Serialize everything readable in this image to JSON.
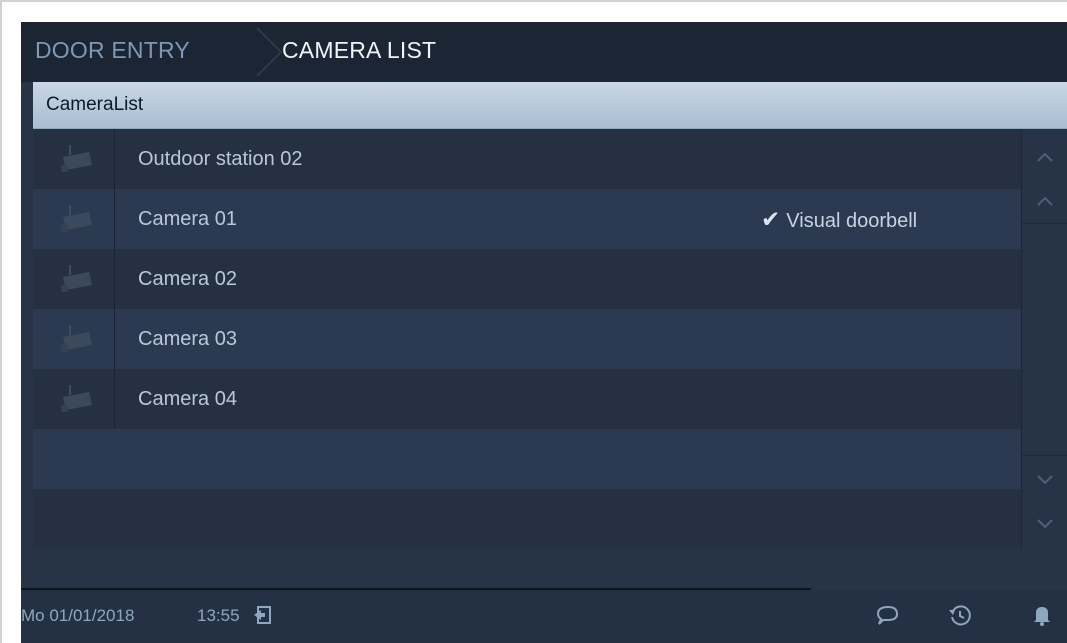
{
  "header": {
    "breadcrumb_1": "DOOR ENTRY",
    "breadcrumb_2": "CAMERA LIST"
  },
  "list": {
    "title": "CameraList",
    "items": [
      {
        "label": "Outdoor station 02",
        "tag": ""
      },
      {
        "label": "Camera 01",
        "tag": "Visual doorbell",
        "checked": true
      },
      {
        "label": "Camera 02",
        "tag": ""
      },
      {
        "label": "Camera 03",
        "tag": ""
      },
      {
        "label": "Camera 04",
        "tag": ""
      }
    ],
    "row_icon": "cctv-camera-icon",
    "check_glyph": "✔"
  },
  "scrollbar": {
    "up_icons": [
      "chevron-up-icon",
      "chevron-up-icon"
    ],
    "down_icons": [
      "chevron-down-icon",
      "chevron-down-icon"
    ]
  },
  "status": {
    "date": "Mo 01/01/2018",
    "time": "13:55",
    "icons": [
      "exit-icon",
      "message-icon",
      "history-icon",
      "bell-icon"
    ]
  },
  "colors": {
    "background": "#273447",
    "header": "#1b2533",
    "title_bar": "#b6c8da",
    "text": "#b9c8d8",
    "accent_text": "#8fa6c0"
  }
}
